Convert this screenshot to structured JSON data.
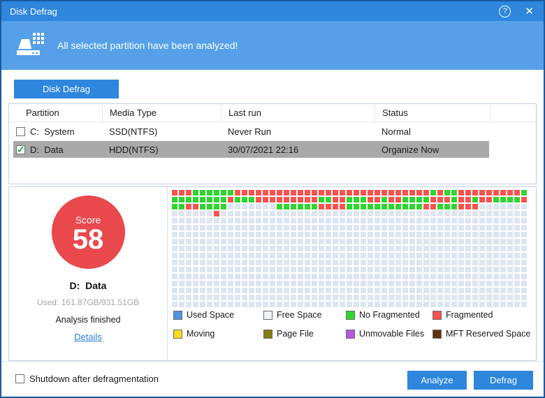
{
  "window": {
    "title": "Disk Defrag",
    "help_icon": "?",
    "close_icon": "✕"
  },
  "banner": {
    "message": "All selected partition have been analyzed!"
  },
  "toolbar": {
    "tab_label": "Disk Defrag"
  },
  "table": {
    "headers": [
      "Partition",
      "Media Type",
      "Last run",
      "Status"
    ],
    "rows": [
      {
        "checked": false,
        "selected": false,
        "partition": "C:  System",
        "media_type": "SSD(NTFS)",
        "last_run": "Never Run",
        "status": "Normal"
      },
      {
        "checked": true,
        "selected": true,
        "partition": "D:  Data",
        "media_type": "HDD(NTFS)",
        "last_run": "30/07/2021 22:16",
        "status": "Organize Now"
      }
    ]
  },
  "score_panel": {
    "score_label": "Score",
    "score_value": "58",
    "drive_label": "D:  Data",
    "used_label": "Used: 161.87GB/931.51GB",
    "status_label": "Analysis finished",
    "details_label": "Details"
  },
  "block_map": {
    "cols": 51,
    "encoding": "R=fragmented, G=no-fragmented, .=free",
    "rows": [
      "RRRGGGGGGRRRRRRRRRRRRRRRRRRRRRRRRRRRRGRGGRRRRRRRRRG",
      "GGGGGGGGRGGGRRRRRRRRRGGRRGGGRRGRRGGGGRRRGRRGRRGGGGR",
      "GGRRGGGG.......GGGGGGRRRRGGGGGGGGGGGRRGGGRRR.......",
      "......R............................................",
      "...................................................",
      "...................................................",
      "...................................................",
      "...................................................",
      "...................................................",
      "...................................................",
      "...................................................",
      "...................................................",
      "...................................................",
      "...................................................",
      "...................................................",
      "...................................................",
      "..................................................."
    ]
  },
  "legend": {
    "items": [
      {
        "label": "Used Space",
        "color": "#4f94dc"
      },
      {
        "label": "Free Space",
        "color": "#eef2f8"
      },
      {
        "label": "No Fragmented",
        "color": "#2ed52e"
      },
      {
        "label": "Fragmented",
        "color": "#f9524e"
      },
      {
        "label": "Moving",
        "color": "#f8da1b"
      },
      {
        "label": "Page File",
        "color": "#867c12"
      },
      {
        "label": "Unmovable Files",
        "color": "#b957e0"
      },
      {
        "label": "MFT Reserved Space",
        "color": "#5f3010"
      }
    ]
  },
  "footer": {
    "shutdown_label": "Shutdown after defragmentation",
    "analyze_label": "Analyze",
    "defrag_label": "Defrag"
  },
  "colors": {
    "titlebar": "#2e86dd",
    "banner": "#55a0e8",
    "accent": "#2e86dd",
    "frame": "#1a5a9e",
    "selected_row": "#a9a9a9",
    "score_red": "#e9484d",
    "cell_free": "#dce5f0",
    "cell_green": "#2ed52e",
    "cell_red": "#f9524e"
  }
}
